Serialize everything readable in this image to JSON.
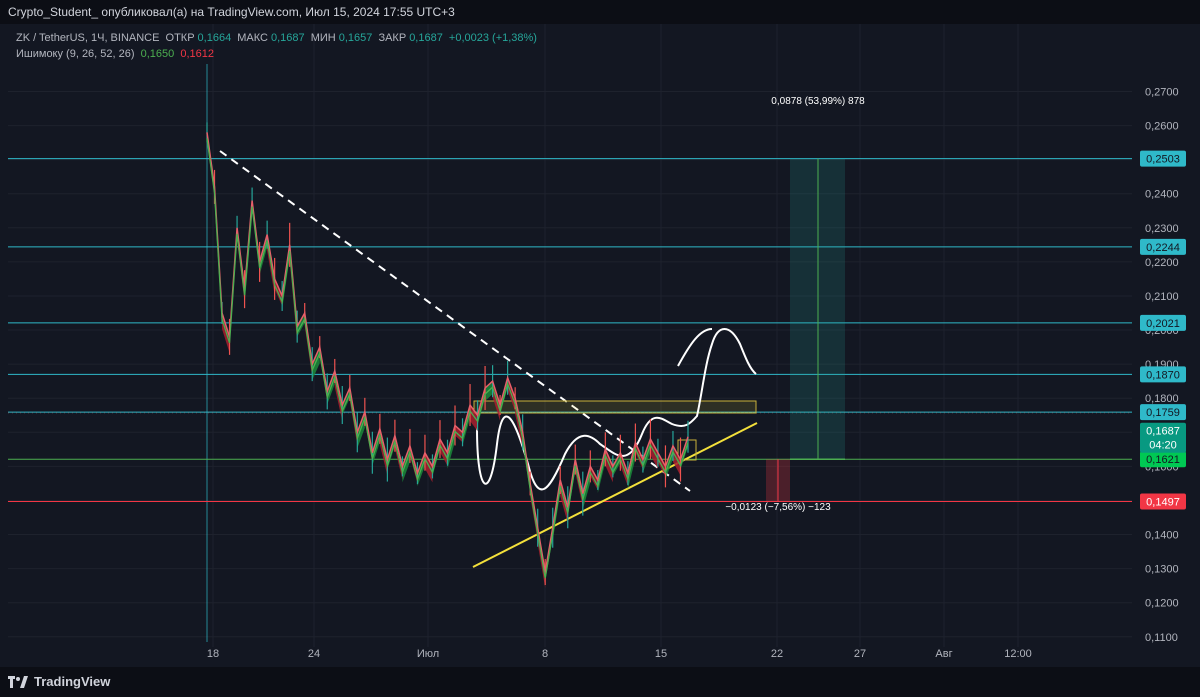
{
  "header": {
    "publish_line": "Crypto_Student_ опубликовал(а) на TradingView.com, Июл 15, 2024 17:55 UTC+3"
  },
  "legend": {
    "symbol": "ZK / TetherUS, 1Ч, BINANCE",
    "open_label": "ОТКР",
    "open_value": "0,1664",
    "high_label": "МАКС",
    "high_value": "0,1687",
    "low_label": "МИН",
    "low_value": "0,1657",
    "close_label": "ЗАКР",
    "close_value": "0,1687",
    "change": "+0,0023 (+1,38%)",
    "indicator": "Ишимоку (9, 26, 52, 26)",
    "ind_val1": "0,1650",
    "ind_val2": "0,1612"
  },
  "footer": {
    "brand": "TradingView"
  },
  "colors": {
    "background": "#131722",
    "grid": "#1e222d",
    "cyan_level": "#2fb9c9",
    "green_level": "#4caf50",
    "red_level": "#f23645",
    "yellow": "#f3e03b",
    "up": "#26a69a",
    "down": "#ef5350"
  },
  "chart_data": {
    "type": "line",
    "title": "ZK / TetherUS, 1Ч, BINANCE",
    "x_ticks": [
      "18",
      "24",
      "Июл",
      "8",
      "15",
      "22",
      "27",
      "Авг",
      "12:00"
    ],
    "y_ticks": [
      "0,2700",
      "0,2600",
      "0,2500",
      "0,2400",
      "0,2300",
      "0,2200",
      "0,2100",
      "0,2000",
      "0,1900",
      "0,1800",
      "0,1700",
      "0,1600",
      "0,1500",
      "0,1400",
      "0,1300",
      "0,1200",
      "0,1100"
    ],
    "ylim": [
      0.107,
      0.281
    ],
    "price_path": [
      [
        0,
        0.258
      ],
      [
        1,
        0.242
      ],
      [
        2,
        0.205
      ],
      [
        3,
        0.198
      ],
      [
        4,
        0.23
      ],
      [
        5,
        0.212
      ],
      [
        6,
        0.238
      ],
      [
        7,
        0.22
      ],
      [
        8,
        0.228
      ],
      [
        9,
        0.215
      ],
      [
        10,
        0.21
      ],
      [
        11,
        0.225
      ],
      [
        12,
        0.201
      ],
      [
        13,
        0.205
      ],
      [
        14,
        0.19
      ],
      [
        15,
        0.195
      ],
      [
        16,
        0.182
      ],
      [
        17,
        0.188
      ],
      [
        18,
        0.178
      ],
      [
        19,
        0.183
      ],
      [
        20,
        0.17
      ],
      [
        21,
        0.176
      ],
      [
        22,
        0.164
      ],
      [
        23,
        0.171
      ],
      [
        24,
        0.162
      ],
      [
        25,
        0.169
      ],
      [
        26,
        0.16
      ],
      [
        27,
        0.166
      ],
      [
        28,
        0.158
      ],
      [
        29,
        0.164
      ],
      [
        30,
        0.16
      ],
      [
        31,
        0.168
      ],
      [
        32,
        0.164
      ],
      [
        33,
        0.172
      ],
      [
        34,
        0.17
      ],
      [
        35,
        0.178
      ],
      [
        36,
        0.175
      ],
      [
        37,
        0.183
      ],
      [
        38,
        0.185
      ],
      [
        39,
        0.178
      ],
      [
        40,
        0.186
      ],
      [
        41,
        0.18
      ],
      [
        42,
        0.17
      ],
      [
        43,
        0.155
      ],
      [
        44,
        0.142
      ],
      [
        45,
        0.129
      ],
      [
        46,
        0.142
      ],
      [
        47,
        0.156
      ],
      [
        48,
        0.148
      ],
      [
        49,
        0.162
      ],
      [
        50,
        0.152
      ],
      [
        51,
        0.16
      ],
      [
        52,
        0.156
      ],
      [
        53,
        0.165
      ],
      [
        54,
        0.16
      ],
      [
        55,
        0.164
      ],
      [
        56,
        0.158
      ],
      [
        57,
        0.167
      ],
      [
        58,
        0.162
      ],
      [
        59,
        0.168
      ],
      [
        60,
        0.164
      ],
      [
        61,
        0.16
      ],
      [
        62,
        0.166
      ],
      [
        63,
        0.162
      ],
      [
        64,
        0.1687
      ]
    ],
    "horizontal_levels": [
      {
        "price": 0.2503,
        "label": "0,2503",
        "kind": "cyan"
      },
      {
        "price": 0.2244,
        "label": "0,2244",
        "kind": "cyan"
      },
      {
        "price": 0.2021,
        "label": "0,2021",
        "kind": "cyan"
      },
      {
        "price": 0.187,
        "label": "0,1870",
        "kind": "cyan"
      },
      {
        "price": 0.1759,
        "label": "0,1759",
        "kind": "cyan"
      },
      {
        "price": 0.1621,
        "label": "0,1621",
        "kind": "green"
      },
      {
        "price": 0.1497,
        "label": "0,1497",
        "kind": "red"
      }
    ],
    "current_price": {
      "label": "0,1687",
      "countdown": "04:20",
      "price": 0.1687
    },
    "annotations": {
      "target": "0,0878 (53,99%) 878",
      "stop": "−0,0123 (−7,56%) −123"
    }
  }
}
